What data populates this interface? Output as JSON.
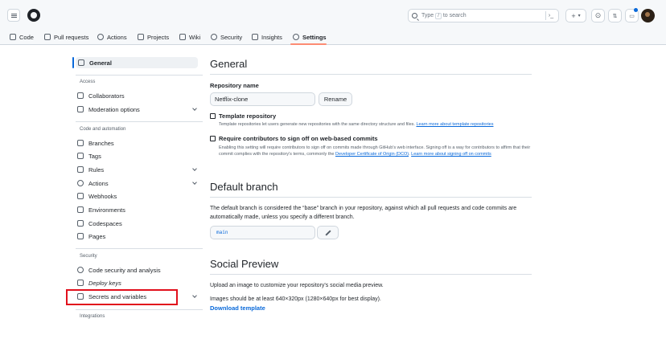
{
  "header": {
    "search_placeholder_pre": "Type",
    "search_slash": "/",
    "search_placeholder_post": "to search",
    "command_icon": "terminal-icon",
    "plus_label": "+",
    "colors": {
      "bg": "#f6f8fa",
      "border": "#d0d7de",
      "notification": "#0969da"
    }
  },
  "repo_nav": {
    "tabs": [
      {
        "label": "Code",
        "icon": "code-icon"
      },
      {
        "label": "Pull requests",
        "icon": "pull-request-icon"
      },
      {
        "label": "Actions",
        "icon": "actions-icon"
      },
      {
        "label": "Projects",
        "icon": "projects-icon"
      },
      {
        "label": "Wiki",
        "icon": "wiki-icon"
      },
      {
        "label": "Security",
        "icon": "shield-icon"
      },
      {
        "label": "Insights",
        "icon": "graph-icon"
      },
      {
        "label": "Settings",
        "icon": "gear-icon",
        "active": true
      }
    ],
    "active_underline_color": "#fd8c73"
  },
  "sidebar": {
    "general": "General",
    "group_access": "Access",
    "collaborators": "Collaborators",
    "moderation": "Moderation options",
    "group_code": "Code and automation",
    "branches": "Branches",
    "tags": "Tags",
    "rules": "Rules",
    "actions": "Actions",
    "webhooks": "Webhooks",
    "environments": "Environments",
    "codespaces": "Codespaces",
    "pages": "Pages",
    "group_security": "Security",
    "code_security": "Code security and analysis",
    "deploy_keys": "Deploy keys",
    "secrets": "Secrets and variables",
    "group_integrations": "Integrations",
    "highlight_color": "#e1101c"
  },
  "main": {
    "title": "General",
    "repo_name_label": "Repository name",
    "repo_name_value": "Netflix-clone",
    "rename": "Rename",
    "template_label": "Template repository",
    "template_desc": "Template repositories let users generate new repositories with the same directory structure and files.",
    "template_link": "Learn more about template repositories",
    "signoff_label": "Require contributors to sign off on web-based commits",
    "signoff_desc": "Enabling this setting will require contributors to sign off on commits made through GitHub's web interface. Signing off is a way for contributors to affirm that their commit complies with the repository's terms, commonly the",
    "signoff_link1": "Developer Certificate of Origin (DCO)",
    "signoff_link2": "Learn more about signing off on commits",
    "default_branch_title": "Default branch",
    "default_branch_desc": "The default branch is considered the “base” branch in your repository, against which all pull requests and code commits are automatically made, unless you specify a different branch.",
    "default_branch_value": "main",
    "social_title": "Social Preview",
    "social_desc": "Upload an image to customize your repository's social media preview.",
    "social_size": "Images should be at least 640×320px (1280×640px for best display).",
    "download_template": "Download template",
    "link_color": "#0969da"
  }
}
